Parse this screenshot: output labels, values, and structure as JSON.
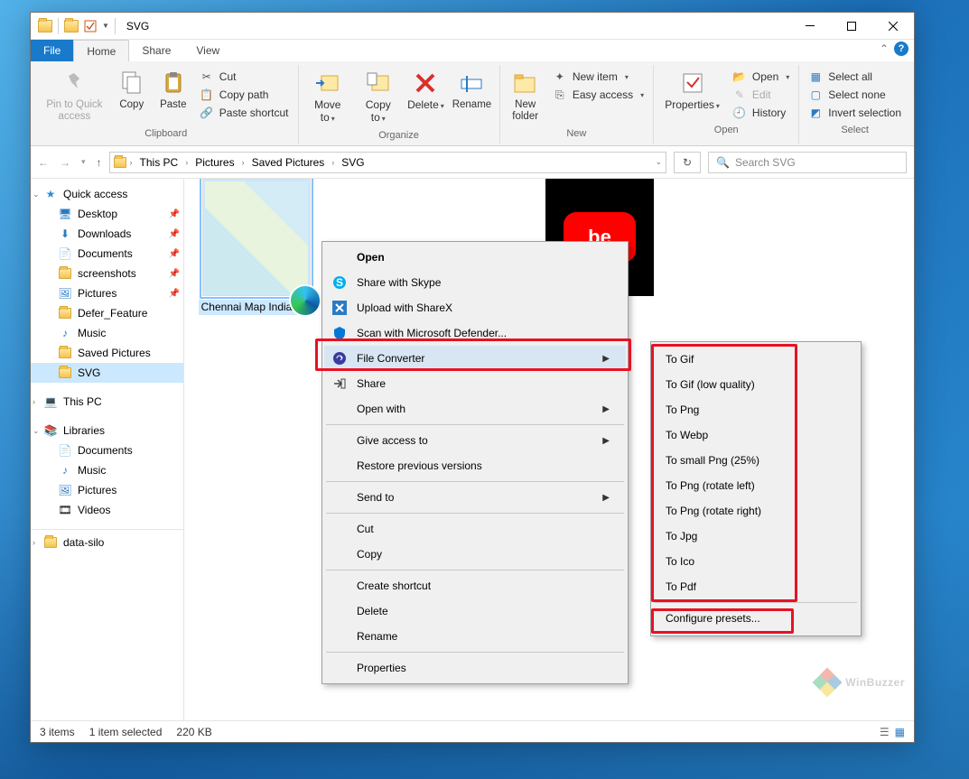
{
  "title": "SVG",
  "tabs": {
    "file": "File",
    "home": "Home",
    "share": "Share",
    "view": "View"
  },
  "ribbon": {
    "clipboard": {
      "pin": "Pin to Quick access",
      "copy": "Copy",
      "paste": "Paste",
      "cut": "Cut",
      "copy_path": "Copy path",
      "paste_shortcut": "Paste shortcut",
      "label": "Clipboard"
    },
    "organize": {
      "move_to": "Move to",
      "copy_to": "Copy to",
      "delete": "Delete",
      "rename": "Rename",
      "label": "Organize"
    },
    "new": {
      "new_folder": "New folder",
      "new_item": "New item",
      "easy_access": "Easy access",
      "label": "New"
    },
    "open": {
      "properties": "Properties",
      "open": "Open",
      "edit": "Edit",
      "history": "History",
      "label": "Open"
    },
    "select": {
      "select_all": "Select all",
      "select_none": "Select none",
      "invert": "Invert selection",
      "label": "Select"
    }
  },
  "breadcrumbs": [
    "This PC",
    "Pictures",
    "Saved Pictures",
    "SVG"
  ],
  "search_placeholder": "Search SVG",
  "sidebar": {
    "quick_access": "Quick access",
    "items": [
      "Desktop",
      "Downloads",
      "Documents",
      "screenshots",
      "Pictures",
      "Defer_Feature",
      "Music",
      "Saved Pictures",
      "SVG"
    ],
    "this_pc": "This PC",
    "libraries": "Libraries",
    "lib_items": [
      "Documents",
      "Music",
      "Pictures",
      "Videos"
    ],
    "last": "data-silo"
  },
  "files": {
    "selected": "Chennai Map India.svg"
  },
  "context_menu": {
    "open": "Open",
    "skype": "Share with Skype",
    "sharex": "Upload with ShareX",
    "defender": "Scan with Microsoft Defender...",
    "file_converter": "File Converter",
    "share": "Share",
    "open_with": "Open with",
    "give_access": "Give access to",
    "restore": "Restore previous versions",
    "send_to": "Send to",
    "cut": "Cut",
    "copy": "Copy",
    "shortcut": "Create shortcut",
    "delete": "Delete",
    "rename": "Rename",
    "properties": "Properties"
  },
  "submenu": {
    "items": [
      "To Gif",
      "To Gif (low quality)",
      "To Png",
      "To Webp",
      "To small Png (25%)",
      "To Png (rotate left)",
      "To Png (rotate right)",
      "To Jpg",
      "To Ico",
      "To Pdf"
    ],
    "configure": "Configure presets..."
  },
  "status": {
    "items": "3 items",
    "selected": "1 item selected",
    "size": "220 KB"
  },
  "watermark": "WinBuzzer"
}
